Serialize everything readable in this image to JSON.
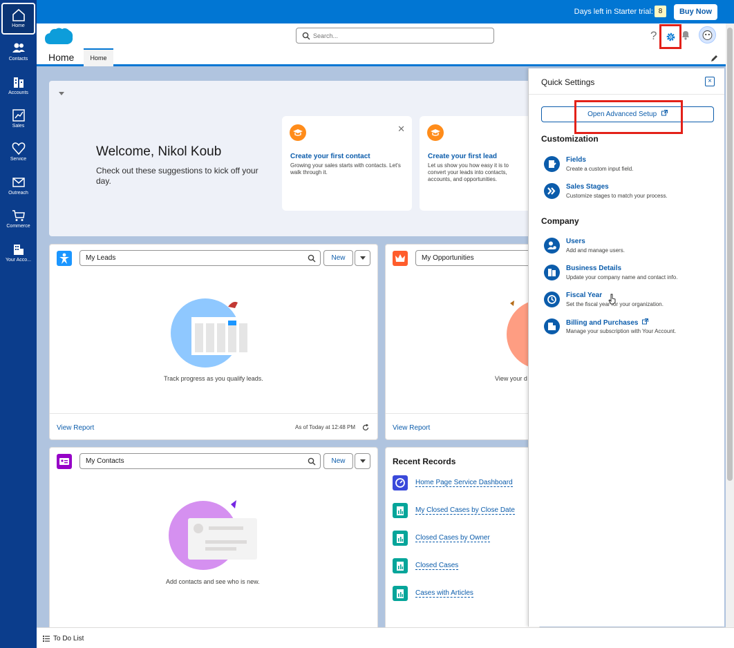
{
  "trial": {
    "text": "Days left in Starter trial:",
    "days": "8",
    "buy_label": "Buy Now"
  },
  "nav": [
    {
      "label": "Home",
      "icon": "home-icon"
    },
    {
      "label": "Contacts",
      "icon": "contacts-icon"
    },
    {
      "label": "Accounts",
      "icon": "accounts-icon"
    },
    {
      "label": "Sales",
      "icon": "sales-icon"
    },
    {
      "label": "Service",
      "icon": "service-icon"
    },
    {
      "label": "Outreach",
      "icon": "outreach-icon"
    },
    {
      "label": "Commerce",
      "icon": "commerce-icon"
    },
    {
      "label": "Your Acco...",
      "icon": "your-account-icon"
    }
  ],
  "header": {
    "search_placeholder": "Search...",
    "help": "?",
    "app_name": "Home",
    "tab_label": "Home"
  },
  "welcome": {
    "title": "Welcome, Nikol Koub",
    "subtitle": "Check out these suggestions to kick off your day.",
    "cards": [
      {
        "title": "Create your first contact",
        "desc": "Growing your sales starts with contacts. Let's walk through it."
      },
      {
        "title": "Create your first lead",
        "desc": "Let us show you how easy it is to convert your leads into contacts, accounts, and opportunities."
      }
    ]
  },
  "leads": {
    "list": "My Leads",
    "new": "New",
    "empty": "Track progress as you qualify leads.",
    "view_report": "View Report",
    "as_of": "As of Today at 12:48 PM"
  },
  "opportunities": {
    "list": "My Opportunities",
    "empty": "View your d",
    "view_report": "View Report"
  },
  "contacts": {
    "list": "My Contacts",
    "new": "New",
    "empty": "Add contacts and see who is new."
  },
  "recent": {
    "title": "Recent Records",
    "items": [
      {
        "label": "Home Page Service Dashboard",
        "icon": "dashboard-icon"
      },
      {
        "label": "My Closed Cases by Close Date",
        "icon": "report-icon"
      },
      {
        "label": "Closed Cases by Owner",
        "icon": "report-icon"
      },
      {
        "label": "Closed Cases",
        "icon": "report-icon"
      },
      {
        "label": "Cases with Articles",
        "icon": "report-icon"
      }
    ]
  },
  "quick_settings": {
    "title": "Quick Settings",
    "close": "×",
    "advanced_setup": "Open Advanced Setup",
    "customization_title": "Customization",
    "customization": [
      {
        "label": "Fields",
        "desc": "Create a custom input field.",
        "icon": "fields-icon"
      },
      {
        "label": "Sales Stages",
        "desc": "Customize stages to match your process.",
        "icon": "sales-stages-icon"
      }
    ],
    "company_title": "Company",
    "company": [
      {
        "label": "Users",
        "desc": "Add and manage users.",
        "icon": "users-icon"
      },
      {
        "label": "Business Details",
        "desc": "Update your company name and contact info.",
        "icon": "business-details-icon"
      },
      {
        "label": "Fiscal Year",
        "desc": "Set the fiscal year for your organization.",
        "icon": "fiscal-year-icon"
      },
      {
        "label": "Billing and Purchases",
        "desc": "Manage your subscription with Your Account.",
        "icon": "billing-icon"
      }
    ]
  },
  "utility": {
    "todo": "To Do List"
  },
  "colors": {
    "brand": "#0176d3",
    "nav": "#0b3d8c",
    "link": "#0b5cab",
    "highlight": "#e32119",
    "leads": "#1b96ff",
    "opportunities": "#ff5d2d",
    "contacts": "#9602c7",
    "report": "#06a59a",
    "dashboard": "#3a49da"
  }
}
